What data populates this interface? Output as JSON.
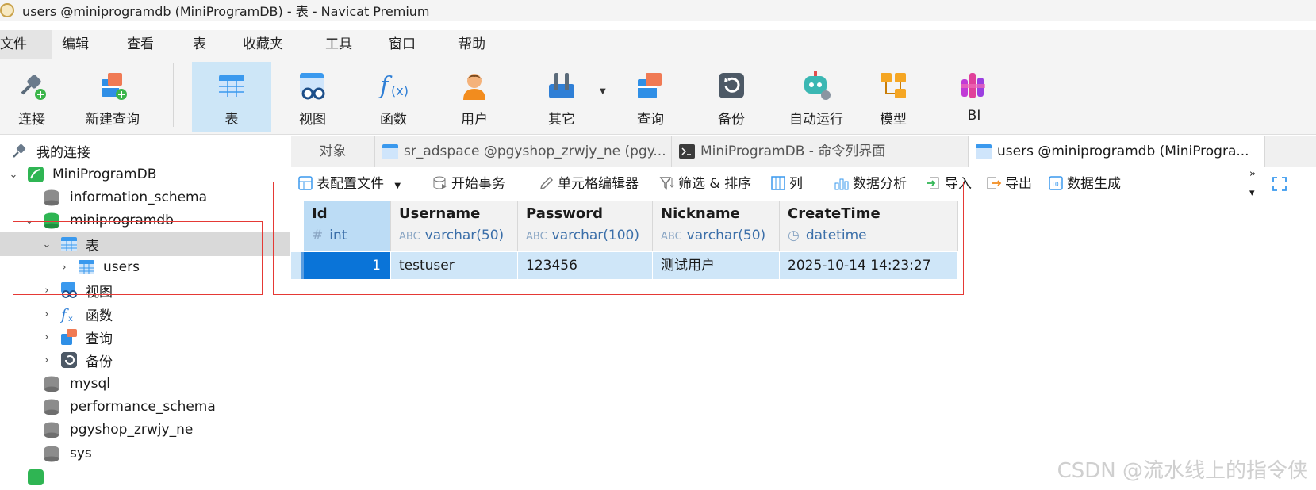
{
  "window": {
    "title": "users @miniprogramdb (MiniProgramDB) - 表 - Navicat Premium"
  },
  "menu": [
    "文件",
    "编辑",
    "查看",
    "表",
    "收藏夹",
    "工具",
    "窗口",
    "帮助"
  ],
  "toolbar": {
    "connect": "连接",
    "new_query": "新建查询",
    "table": "表",
    "view": "视图",
    "function": "函数",
    "user": "用户",
    "other": "其它",
    "query": "查询",
    "backup": "备份",
    "automation": "自动运行",
    "model": "模型",
    "bi": "BI"
  },
  "sidebar": {
    "header": "我的连接",
    "items": [
      {
        "label": "MiniProgramDB"
      },
      {
        "label": "information_schema"
      },
      {
        "label": "miniprogramdb"
      },
      {
        "label": "表"
      },
      {
        "label": "users"
      },
      {
        "label": "视图"
      },
      {
        "label": "函数"
      },
      {
        "label": "查询"
      },
      {
        "label": "备份"
      },
      {
        "label": "mysql"
      },
      {
        "label": "performance_schema"
      },
      {
        "label": "pgyshop_zrwjy_ne"
      },
      {
        "label": "sys"
      }
    ]
  },
  "tabs": [
    {
      "label": "对象"
    },
    {
      "label": "sr_adspace @pgyshop_zrwjy_ne (pgy..."
    },
    {
      "label": "MiniProgramDB - 命令列界面"
    },
    {
      "label": "users @miniprogramdb (MiniProgra..."
    }
  ],
  "table_toolbar": {
    "config_file": "表配置文件",
    "begin_transaction": "开始事务",
    "cell_editor": "单元格编辑器",
    "filter_sort": "筛选 & 排序",
    "columns": "列",
    "data_analysis": "数据分析",
    "import": "导入",
    "export": "导出",
    "data_generation": "数据生成"
  },
  "grid": {
    "columns": [
      {
        "name": "Id",
        "type": "int"
      },
      {
        "name": "Username",
        "type": "varchar(50)"
      },
      {
        "name": "Password",
        "type": "varchar(100)"
      },
      {
        "name": "Nickname",
        "type": "varchar(50)"
      },
      {
        "name": "CreateTime",
        "type": "datetime"
      }
    ],
    "rows": [
      [
        "1",
        "testuser",
        "123456",
        "测试用户",
        "2025-10-14 14:23:27"
      ]
    ]
  },
  "watermark": "CSDN @流水线上的指令侠"
}
